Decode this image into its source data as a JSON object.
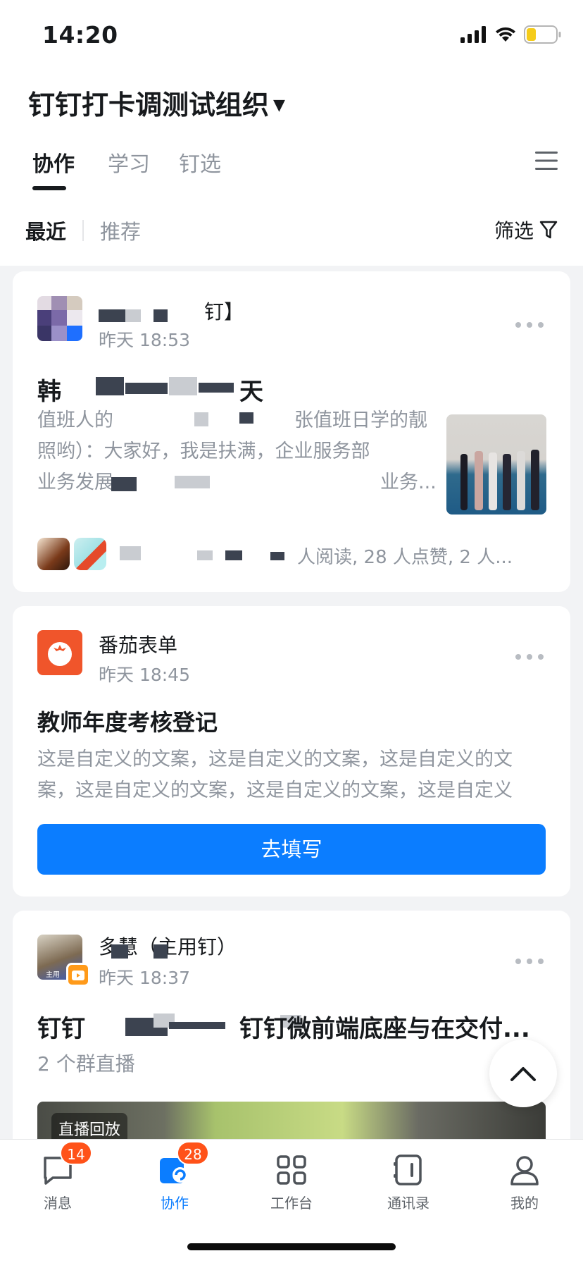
{
  "status_bar": {
    "time": "14:20"
  },
  "header": {
    "org_title": "钉钉打卡调测试组织",
    "tabs": [
      {
        "label": "协作",
        "active": true
      },
      {
        "label": "学习",
        "active": false
      },
      {
        "label": "钉选",
        "active": false
      }
    ]
  },
  "subtabs": {
    "recent": "最近",
    "recommend": "推荐",
    "filter": "筛选"
  },
  "cards": [
    {
      "sender": "钉】",
      "time": "昨天 18:53",
      "title_start": "韩",
      "title_end": "天",
      "desc_lines": [
        "值班人的",
        "张值班日学的靓",
        "照哟）：大家好，我是扶满，企业服务部",
        "业务发展",
        "业务..."
      ],
      "read_stats": "人阅读, 28 人点赞, 2 人..."
    },
    {
      "sender": "番茄表单",
      "time": "昨天 18:45",
      "title": "教师年度考核登记",
      "desc_lines": [
        "这是自定义的文案，这是自定义的文案，这是自定义的文",
        "案，这是自定义的文案，这是自定义的文案，这是自定义"
      ],
      "button": "去填写"
    },
    {
      "sender": "多慧（主用钉）",
      "time": "昨天 18:37",
      "avatar_tag": "主用",
      "title_start": "钉钉",
      "title_end": "钉钉微前端底座与在交付...",
      "subtitle": "2 个群直播",
      "video_tag": "直播回放"
    }
  ],
  "tabbar": [
    {
      "label": "消息",
      "badge": "14",
      "icon": "message-icon",
      "active": false
    },
    {
      "label": "协作",
      "badge": "28",
      "icon": "collab-icon",
      "active": true
    },
    {
      "label": "工作台",
      "badge": "",
      "icon": "grid-icon",
      "active": false
    },
    {
      "label": "通讯录",
      "badge": "",
      "icon": "contacts-icon",
      "active": false
    },
    {
      "label": "我的",
      "badge": "",
      "icon": "profile-icon",
      "active": false
    }
  ],
  "colors": {
    "accent": "#0b7dff",
    "badge": "#ff5219",
    "tomato": "#f0552b"
  }
}
